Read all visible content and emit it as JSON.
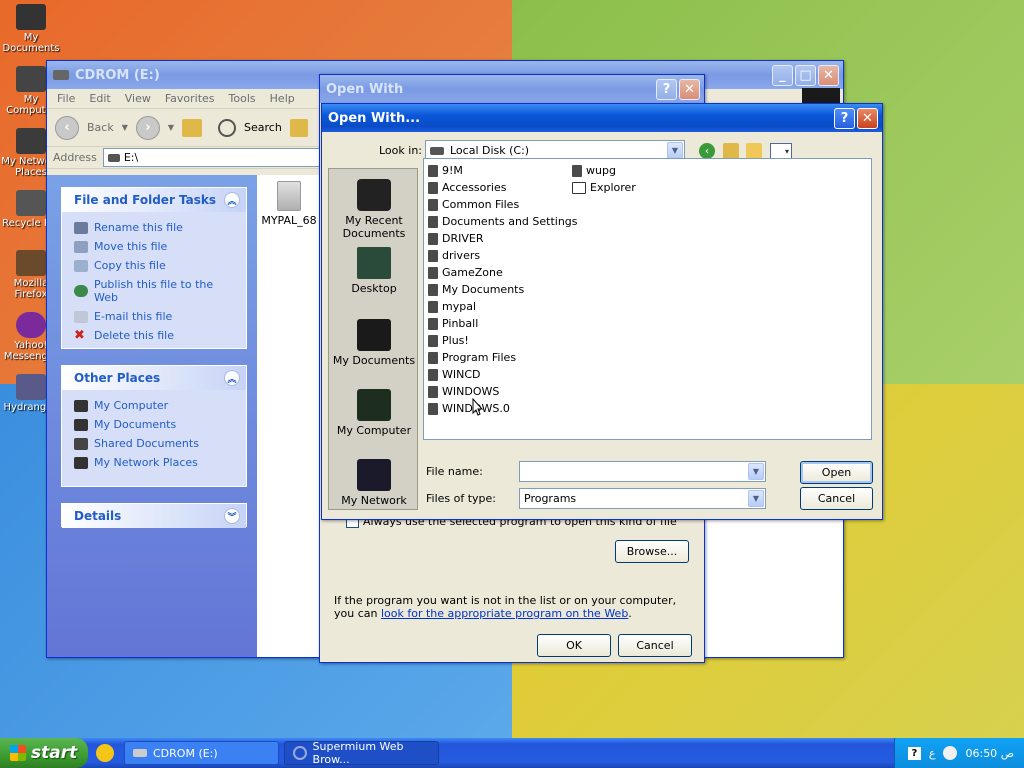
{
  "desktop_icons": [
    {
      "label": "My Documents"
    },
    {
      "label": "My Computer"
    },
    {
      "label": "My Network Places"
    },
    {
      "label": "Recycle Bin"
    },
    {
      "label": "Mozilla Firefox"
    },
    {
      "label": "Yahoo! Messenger"
    },
    {
      "label": "Hydrangea"
    }
  ],
  "explorer": {
    "title": "CDROM (E:)",
    "menu": [
      "File",
      "Edit",
      "View",
      "Favorites",
      "Tools",
      "Help"
    ],
    "back_label": "Back",
    "search_label": "Search",
    "address_label": "Address",
    "address_value": "E:\\",
    "file_folder_tasks": {
      "title": "File and Folder Tasks",
      "items": [
        "Rename this file",
        "Move this file",
        "Copy this file",
        "Publish this file to the Web",
        "E-mail this file",
        "Delete this file"
      ]
    },
    "other_places": {
      "title": "Other Places",
      "items": [
        "My Computer",
        "My Documents",
        "Shared Documents",
        "My Network Places"
      ]
    },
    "details": {
      "title": "Details"
    },
    "file_label": "MYPAL_68"
  },
  "open_with_back": {
    "title": "Open With",
    "always_use": "Always use the selected program to open this kind of file",
    "browse": "Browse...",
    "info_text": "If the program you want is not in the list or on your computer, you can ",
    "info_link": "look for the appropriate program on the Web",
    "info_end": ".",
    "ok": "OK",
    "cancel": "Cancel"
  },
  "open_with_dialog": {
    "title": "Open With...",
    "look_in_label": "Look in:",
    "look_in_value": "Local Disk (C:)",
    "places": [
      "My Recent Documents",
      "Desktop",
      "My Documents",
      "My Computer",
      "My Network"
    ],
    "files_col1": [
      "9!M",
      "Accessories",
      "Common Files",
      "Documents and Settings",
      "DRIVER",
      "drivers",
      "GameZone",
      "My Documents",
      "mypal",
      "Pinball",
      "Plus!",
      "Program Files",
      "WINCD",
      "WINDOWS",
      "WINDOWS.0"
    ],
    "files_col2": [
      "wupg",
      "Explorer"
    ],
    "file_name_label": "File name:",
    "file_name_value": "",
    "files_of_type_label": "Files of type:",
    "files_of_type_value": "Programs",
    "open": "Open",
    "cancel": "Cancel"
  },
  "taskbar": {
    "start": "start",
    "items": [
      "CDROM (E:)",
      "Supermium Web Brow..."
    ],
    "clock": "06:50 ص"
  }
}
